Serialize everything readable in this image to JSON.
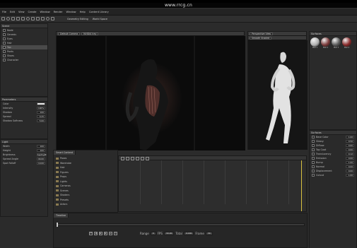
{
  "watermark": "www.rrcg.cn",
  "menu": [
    "File",
    "Edit",
    "View",
    "Create",
    "Window",
    "Render",
    "Window",
    "Help",
    "Content Library"
  ],
  "toolbar": {
    "buttons": [
      "Universal",
      "Translate",
      "Rotate",
      "Scale",
      "Active Pose",
      "Surface",
      "Lights"
    ],
    "right_items": [
      "Default Selection",
      "Undo",
      "Redo"
    ],
    "labels": [
      "Geometry Editing",
      "World Space"
    ]
  },
  "left_panel": {
    "tab": "Scene",
    "items": [
      "Node",
      "Genesis",
      "Eyes",
      "Hair",
      "Top",
      "Pants",
      "Shoes",
      "Character"
    ],
    "selected_index": 4
  },
  "left_props": {
    "header": "Parameters",
    "rows": [
      {
        "label": "Color",
        "value": "",
        "swatch": true
      },
      {
        "label": "Intensity",
        "value": "100%"
      },
      {
        "label": "Shadow",
        "value": "100"
      },
      {
        "label": "Spread",
        "value": "0.25"
      },
      {
        "label": "Shadow Softness",
        "value": "5.00"
      }
    ]
  },
  "left_props2": {
    "header": "Light",
    "rows": [
      {
        "label": "Width",
        "value": "100"
      },
      {
        "label": "Height",
        "value": "100"
      },
      {
        "label": "Brightness",
        "value": "Spotlight"
      },
      {
        "label": "Spread Angle",
        "value": "90.00"
      },
      {
        "label": "Spot Falloff",
        "value": "10.00"
      }
    ]
  },
  "viewport_left": {
    "camera": "Default Camera",
    "mode": "NVIDIA Iray"
  },
  "viewport_right": {
    "camera": "Perspective View",
    "mode": "Smooth Shaded"
  },
  "surfaces": {
    "header": "Surfaces",
    "materials": [
      {
        "name": "Mat 1",
        "color": "#b0b0b0"
      },
      {
        "name": "Mat 2",
        "color": "#7a3a3a"
      },
      {
        "name": "Mat 3",
        "color": "#5a5a5a"
      },
      {
        "name": "Mat 4",
        "color": "#8a2a2a"
      }
    ]
  },
  "right_props": {
    "header": "Surfaces",
    "sections": [
      "Base Color",
      "Glossy",
      "Diffuse",
      "Top Coat",
      "Translucency",
      "Emission",
      "Bump",
      "Normal",
      "Displacement",
      "Cutout"
    ],
    "values": [
      "1.00",
      "0.50",
      "0.60",
      "0.00",
      "0.12",
      "0.00",
      "1.00",
      "0.00",
      "0.00",
      "1.00"
    ]
  },
  "content_panel": {
    "tab": "Smart Content",
    "items": [
      "Poses",
      "Wardrobe",
      "Hair",
      "Figures",
      "Props",
      "Lights",
      "Cameras",
      "Scenes",
      "Shaders",
      "Presets",
      "Actors"
    ]
  },
  "timeline": {
    "tab": "Timeline",
    "labels": [
      "Ex",
      "Range",
      "FPS",
      "Total",
      "Frame"
    ],
    "values": [
      "0",
      "30.00",
      "0.000",
      "30"
    ]
  }
}
